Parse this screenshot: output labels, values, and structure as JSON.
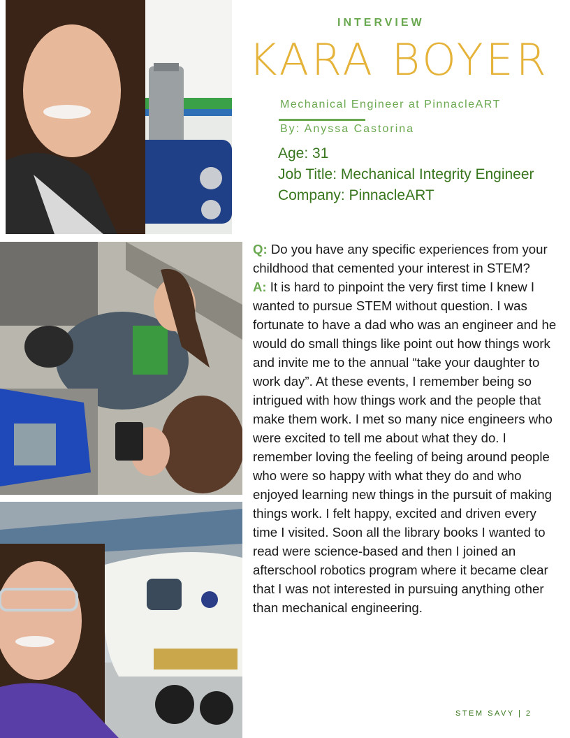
{
  "header": {
    "kicker": "INTERVIEW",
    "name": "KARA BOYER",
    "subtitle": "Mechanical Engineer at PinnacleART",
    "byline": "By: Anyssa Castorina"
  },
  "facts": {
    "age": "Age: 31",
    "job_title": "Job Title:  Mechanical Integrity Engineer",
    "company": "Company:  PinnacleART"
  },
  "qa": {
    "q_label": "Q:",
    "question": "Do you have any specific experiences from your childhood that cemented your interest in STEM?",
    "a_label": "A:",
    "answer": "It is hard to pinpoint the very first time I knew I wanted to pursue STEM without question. I was fortunate to have a dad who was an engineer and he would do small things like point out how things work and invite me to the annual “take your daughter to work day”. At these events, I remember being so intrigued with how things work and the people that make them work. I met so many nice engineers who were excited to tell me about what they do. I remember loving the feeling of being around people who were so happy with what they do and who enjoyed learning new things in the pursuit of making things work. I felt happy, excited and driven every time I visited. Soon all the library books I wanted to read were science-based and then I joined an afterschool robotics program where it became clear that I was not interested in pursuing anything other than mechanical engineering."
  },
  "footer": {
    "text": "STEM SAVY  |  2"
  },
  "colors": {
    "accent_green": "#6aa84f",
    "dark_green": "#38761d",
    "title_gold": "#e6b33a"
  }
}
